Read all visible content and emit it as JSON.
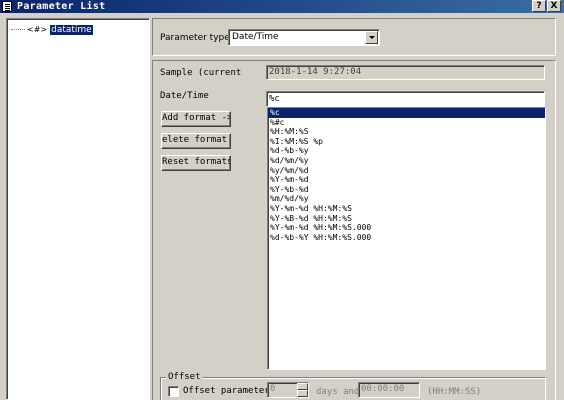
{
  "window": {
    "title": "Parameter List",
    "help_btn": "?",
    "close_btn": "X"
  },
  "tree": {
    "node_badge": "<#>",
    "node_label": "datatime"
  },
  "param_type": {
    "label": "Parameter type:",
    "value": "Date/Time"
  },
  "sample": {
    "label": "Sample (current",
    "value": "2018-1-14 9:27:04"
  },
  "datetime": {
    "label": "Date/Time",
    "value": "%c"
  },
  "buttons": {
    "add": "Add format ->",
    "delete": "elete format <",
    "reset": "Reset formats"
  },
  "formats": [
    "%c",
    "%#c",
    "%H:%M:%S",
    "%I:%M:%S %p",
    "%d-%b-%y",
    "%d/%m/%y",
    "%y/%m/%d",
    "%Y-%m-%d",
    "%Y-%b-%d",
    "%m/%d/%y",
    "%Y-%m-%d %H:%M:%S",
    "%Y-%B-%d %H:%M:%S",
    "%Y-%m-%d %H:%M:%S.000",
    "%d-%b-%Y %H:%M:%S.000"
  ],
  "offset": {
    "group_title": "Offset",
    "checkbox_label": "Offset parameter",
    "days_value": "0",
    "days_label": "days and",
    "time_value": "00:00:00",
    "time_hint": "(HH:MM:SS)"
  }
}
